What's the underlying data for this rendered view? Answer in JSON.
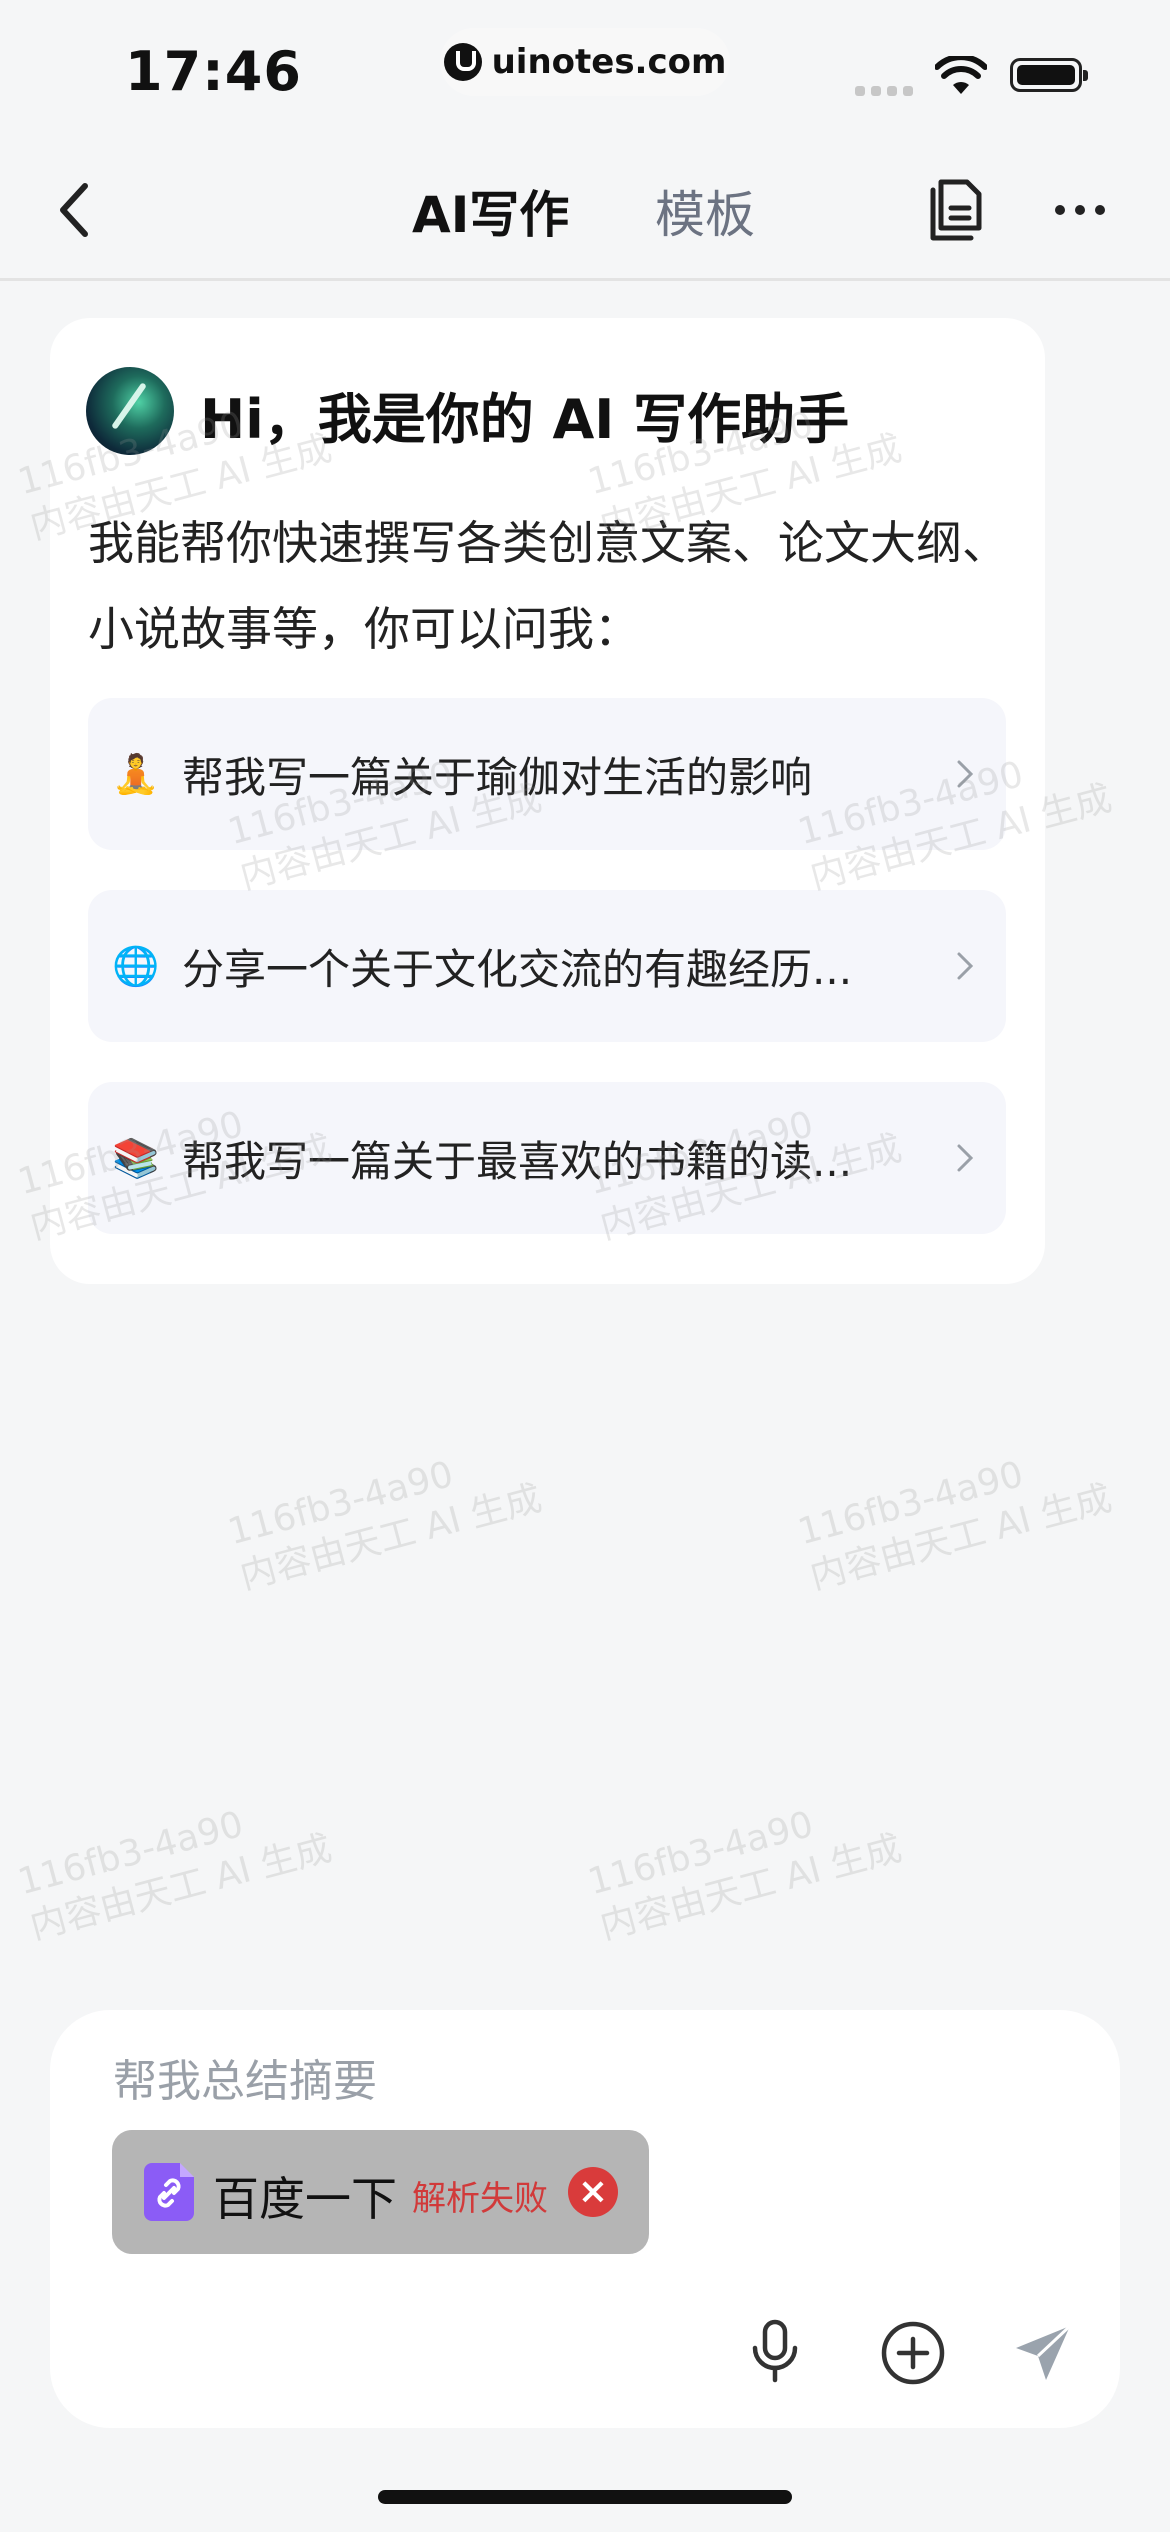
{
  "status_bar": {
    "time": "17:46",
    "url": "uinotes.com"
  },
  "nav": {
    "back_icon": "chevron-left-icon",
    "tab_active": "AI写作",
    "tab_other": "模板",
    "doc_icon": "documents-icon",
    "more_icon": "more-icon"
  },
  "intro_card": {
    "greeting": "Hi，我是你的 AI 写作助手",
    "description": "我能帮你快速撰写各类创意文案、论文大纲、小说故事等，你可以问我：",
    "suggestions": [
      {
        "emoji": "🧘",
        "text": "帮我写一篇关于瑜伽对生活的影响"
      },
      {
        "emoji": "🌐",
        "text": "分享一个关于文化交流的有趣经历..."
      },
      {
        "emoji": "📚",
        "text": "帮我写一篇关于最喜欢的书籍的读..."
      }
    ]
  },
  "watermark": {
    "line1": "116fb3-4a90",
    "line2": "内容由天工 AI 生成"
  },
  "composer": {
    "placeholder": "帮我总结摘要",
    "attachment": {
      "title": "百度一下",
      "status": "解析失败",
      "status_color": "#d13a3a",
      "icon_color": "#8b5cf6"
    },
    "icons": [
      "microphone-icon",
      "plus-circle-icon",
      "send-icon"
    ]
  }
}
